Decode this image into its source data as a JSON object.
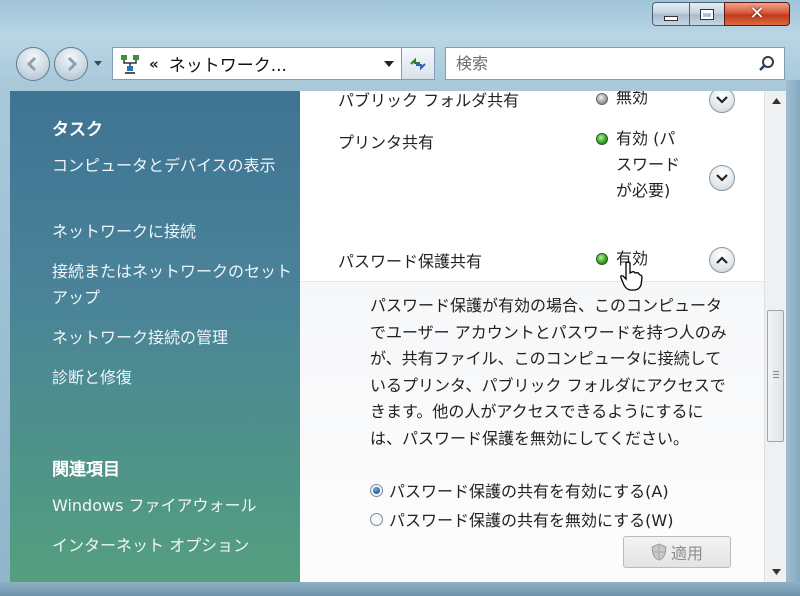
{
  "address": {
    "path_text": "ネットワーク..."
  },
  "search": {
    "placeholder": "検索"
  },
  "sidebar": {
    "tasks_heading": "タスク",
    "task_links": [
      "コンピュータとデバイスの表示",
      "ネットワークに接続",
      "接続またはネットワークのセットアップ",
      "ネットワーク接続の管理",
      "診断と修復"
    ],
    "related_heading": "関連項目",
    "related_links": [
      "Windows ファイアウォール",
      "インターネット オプション"
    ]
  },
  "sharing": {
    "public_folder": {
      "label": "パブリック フォルダ共有",
      "status": "無効"
    },
    "printer": {
      "label": "プリンタ共有",
      "status": "有効 (パスワードが必要)"
    },
    "password": {
      "label": "パスワード保護共有",
      "status": "有効",
      "description": "パスワード保護が有効の場合、このコンピュータでユーザー アカウントとパスワードを持つ人のみが、共有ファイル、このコンピュータに接続しているプリンタ、パブリック フォルダにアクセスできます。他の人がアクセスできるようにするには、パスワード保護を無効にしてください。",
      "option_on": "パスワード保護の共有を有効にする(A)",
      "option_off": "パスワード保護の共有を無効にする(W)",
      "apply_label": "適用"
    }
  },
  "colors": {
    "status_on": "#3aa626",
    "accent": "#1f5ca8"
  },
  "icons": [
    "back-arrow-icon",
    "forward-arrow-icon",
    "network-icon",
    "refresh-icon",
    "search-icon",
    "chevron-up-icon",
    "chevron-down-icon",
    "shield-icon"
  ]
}
